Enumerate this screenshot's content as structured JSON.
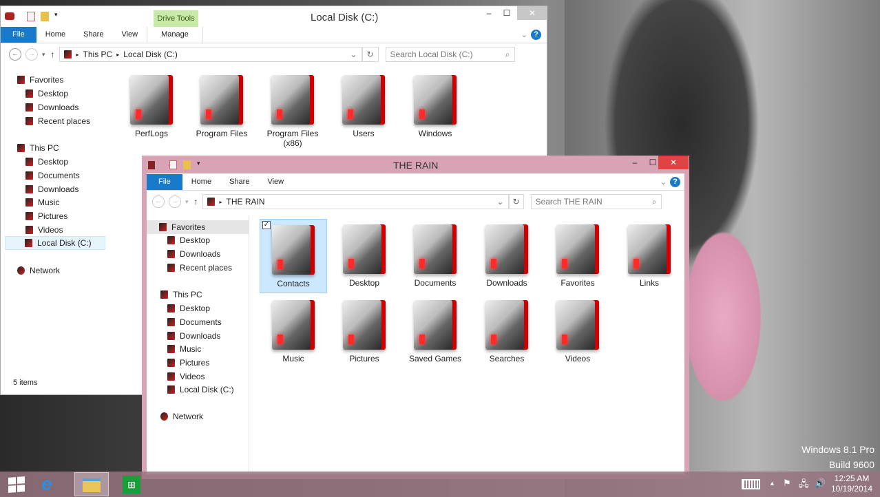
{
  "desktop": {
    "watermark_line1": "Windows 8.1 Pro",
    "watermark_line2": "Build 9600"
  },
  "window_back": {
    "title": "Local Disk (C:)",
    "context_tab_group": "Drive Tools",
    "tabs": [
      "File",
      "Home",
      "Share",
      "View",
      "Manage"
    ],
    "breadcrumb": [
      "This PC",
      "Local Disk (C:)"
    ],
    "search_placeholder": "Search Local Disk (C:)",
    "sidebar": {
      "favorites": "Favorites",
      "favorites_items": [
        "Desktop",
        "Downloads",
        "Recent places"
      ],
      "this_pc": "This PC",
      "this_pc_items": [
        "Desktop",
        "Documents",
        "Downloads",
        "Music",
        "Pictures",
        "Videos",
        "Local Disk (C:)"
      ],
      "network": "Network",
      "selected": "Local Disk (C:)"
    },
    "folders": [
      "PerfLogs",
      "Program Files",
      "Program Files (x86)",
      "Users",
      "Windows"
    ],
    "status": "5 items"
  },
  "window_front": {
    "title": "THE RAIN",
    "tabs": [
      "File",
      "Home",
      "Share",
      "View"
    ],
    "breadcrumb": [
      "THE RAIN"
    ],
    "search_placeholder": "Search THE RAIN",
    "sidebar": {
      "favorites": "Favorites",
      "favorites_items": [
        "Desktop",
        "Downloads",
        "Recent places"
      ],
      "this_pc": "This PC",
      "this_pc_items": [
        "Desktop",
        "Documents",
        "Downloads",
        "Music",
        "Pictures",
        "Videos",
        "Local Disk (C:)"
      ],
      "network": "Network"
    },
    "folders": [
      "Contacts",
      "Desktop",
      "Documents",
      "Downloads",
      "Favorites",
      "Links",
      "Music",
      "Pictures",
      "Saved Games",
      "Searches",
      "Videos"
    ],
    "selected": "Contacts",
    "accent": "#d9a3b6"
  },
  "taskbar": {
    "time": "12:25 AM",
    "date": "10/19/2014",
    "apps": [
      "start-icon",
      "internet-explorer-icon",
      "file-explorer-icon",
      "store-icon"
    ]
  },
  "colors": {
    "file_tab": "#1979ca",
    "close_button": "#c7c7c7",
    "taskbar": "#96737f"
  }
}
